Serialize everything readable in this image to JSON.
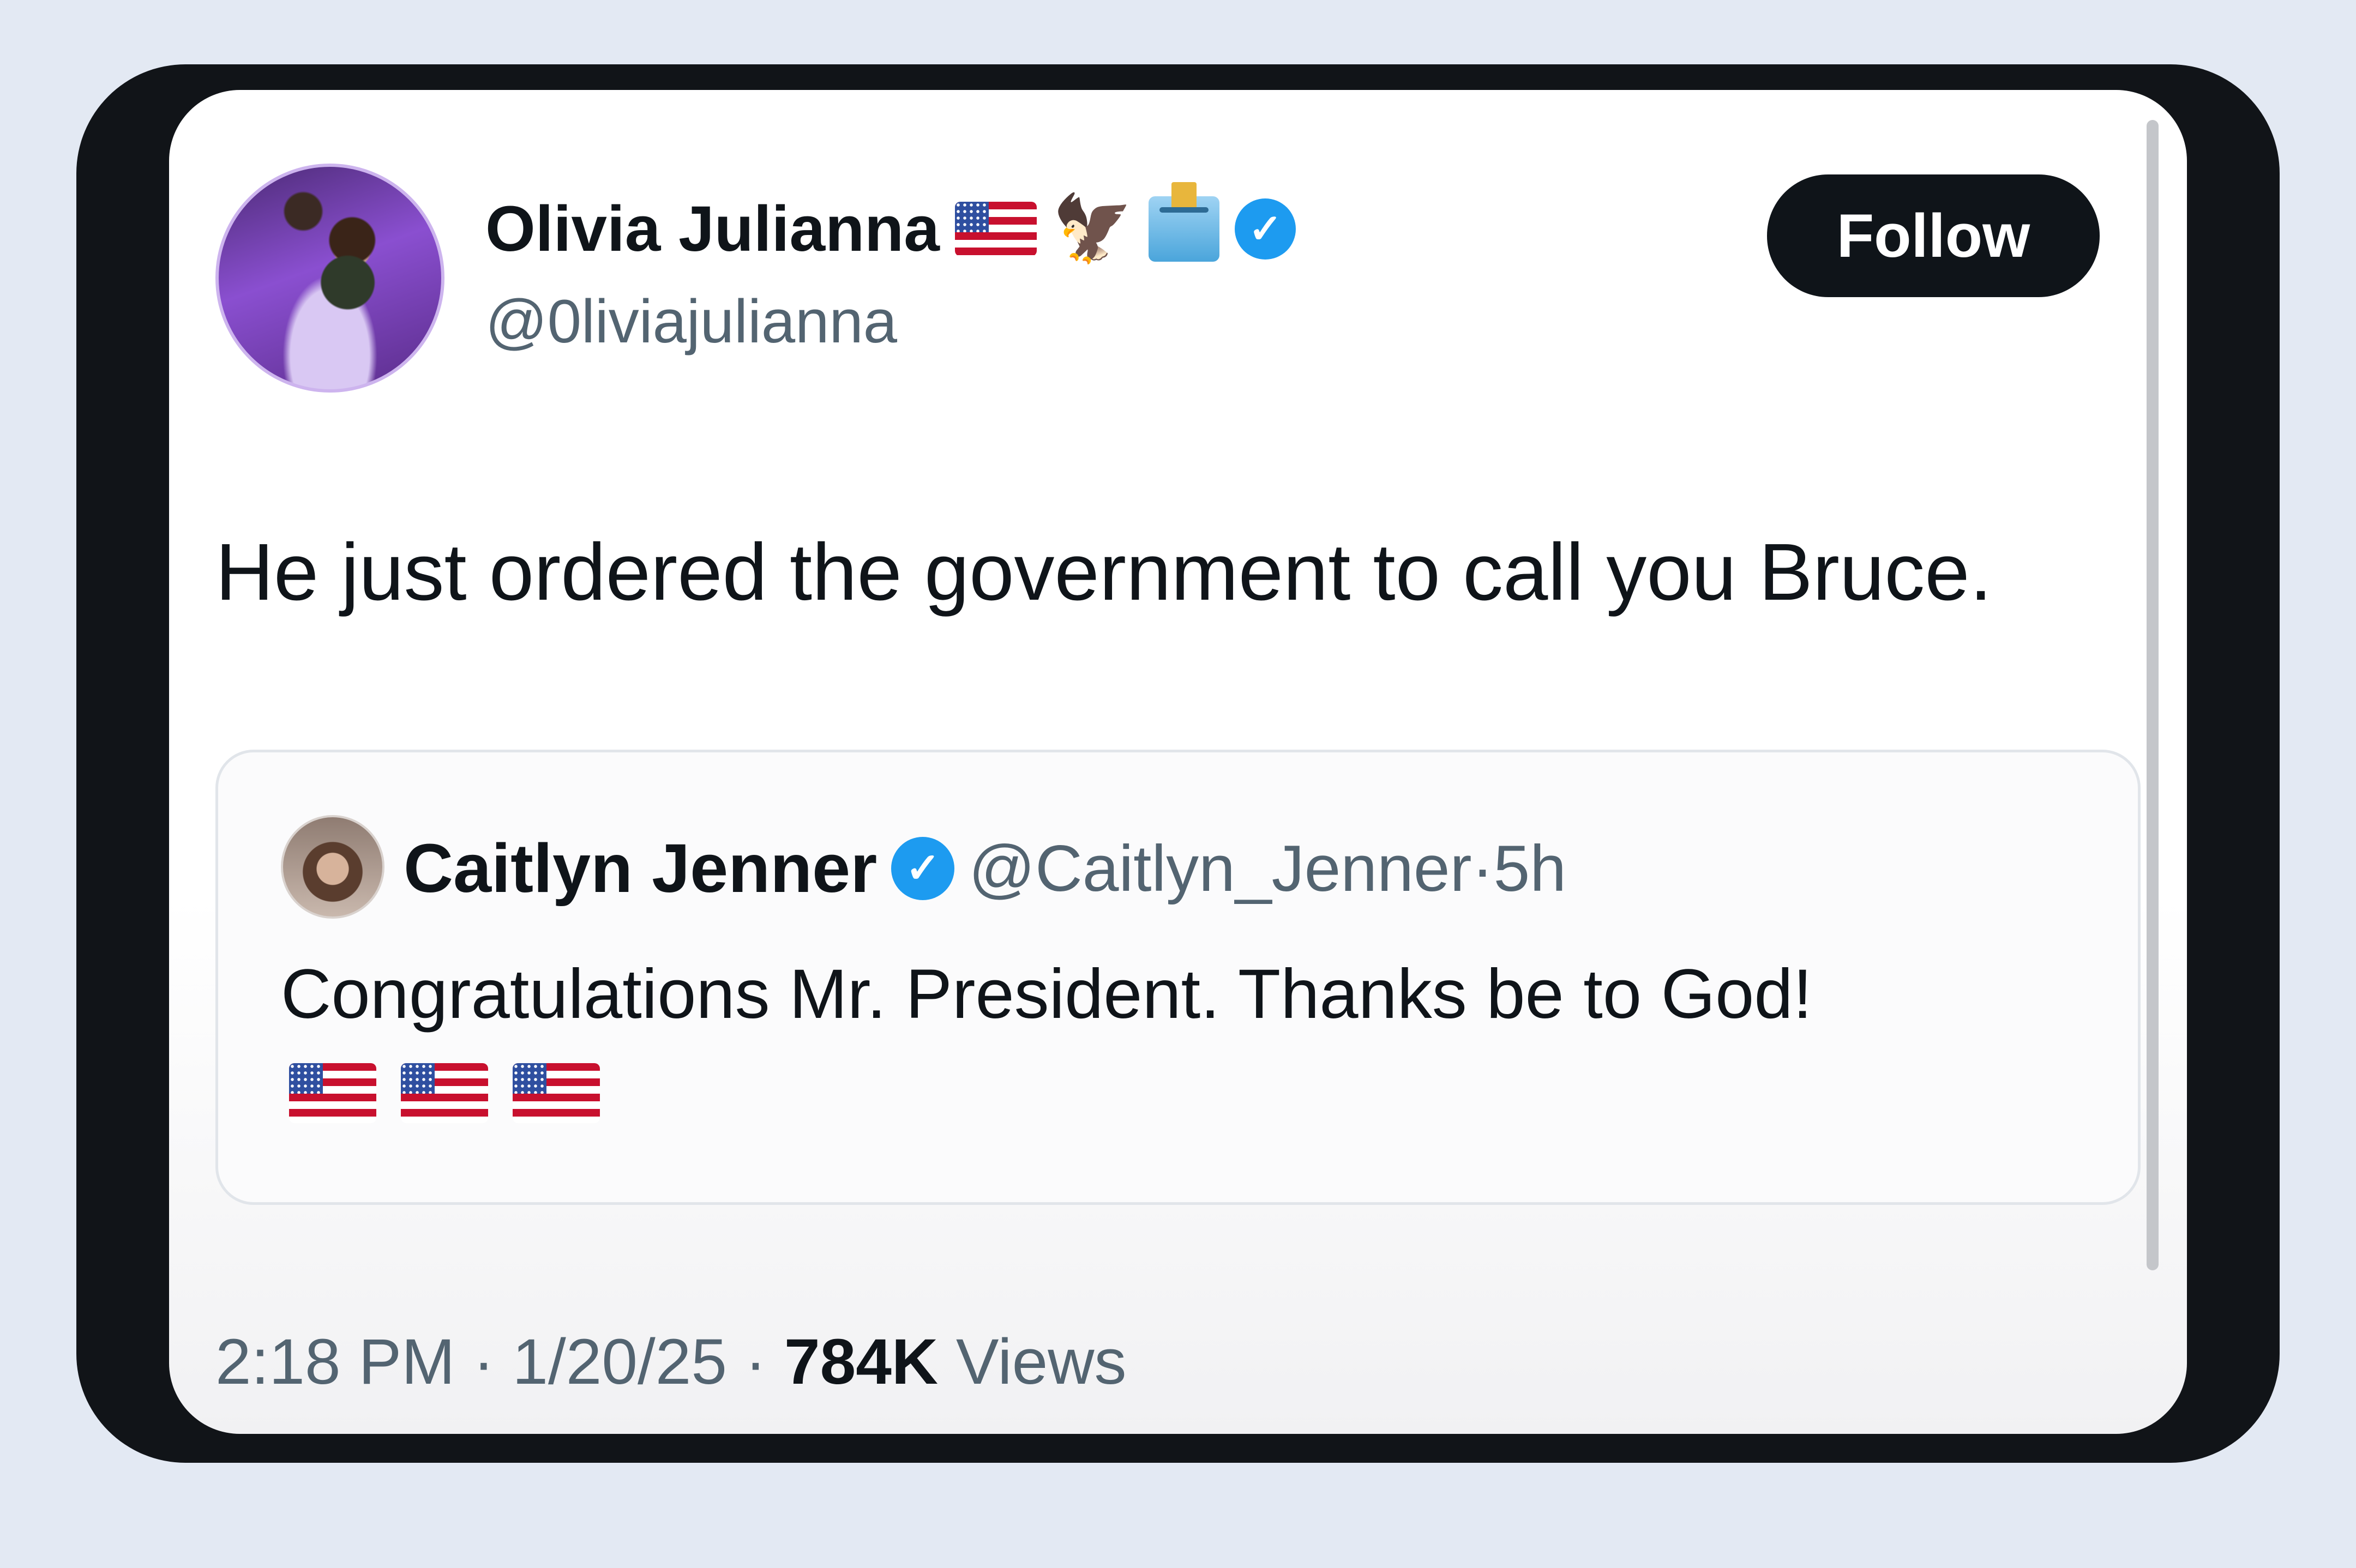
{
  "tweet": {
    "author_name": "Olivia Julianna",
    "author_handle": "@0liviajulianna",
    "name_emojis": [
      "flag-us-icon",
      "eagle-icon",
      "ballot-box-icon"
    ],
    "verified_icon": "verified-badge-icon",
    "follow_label": "Follow",
    "text": "He just ordered the government to call you Bruce.",
    "time": "2:18 PM",
    "date": "1/20/25",
    "views_count": "784K",
    "views_label": "Views",
    "separator": "·"
  },
  "quoted_tweet": {
    "author_name": "Caitlyn Jenner",
    "author_handle": "@Caitlyn_Jenner",
    "age": "5h",
    "separator": "·",
    "text": "Congratulations Mr. President. Thanks be to God!",
    "emojis": [
      "flag-us-icon",
      "flag-us-icon",
      "flag-us-icon"
    ]
  },
  "colors": {
    "verified": "#1d9bf0",
    "follow_bg": "#0f1419",
    "frame": "#111418",
    "page_bg": "#e3e9f3",
    "secondary_text": "#536471"
  }
}
